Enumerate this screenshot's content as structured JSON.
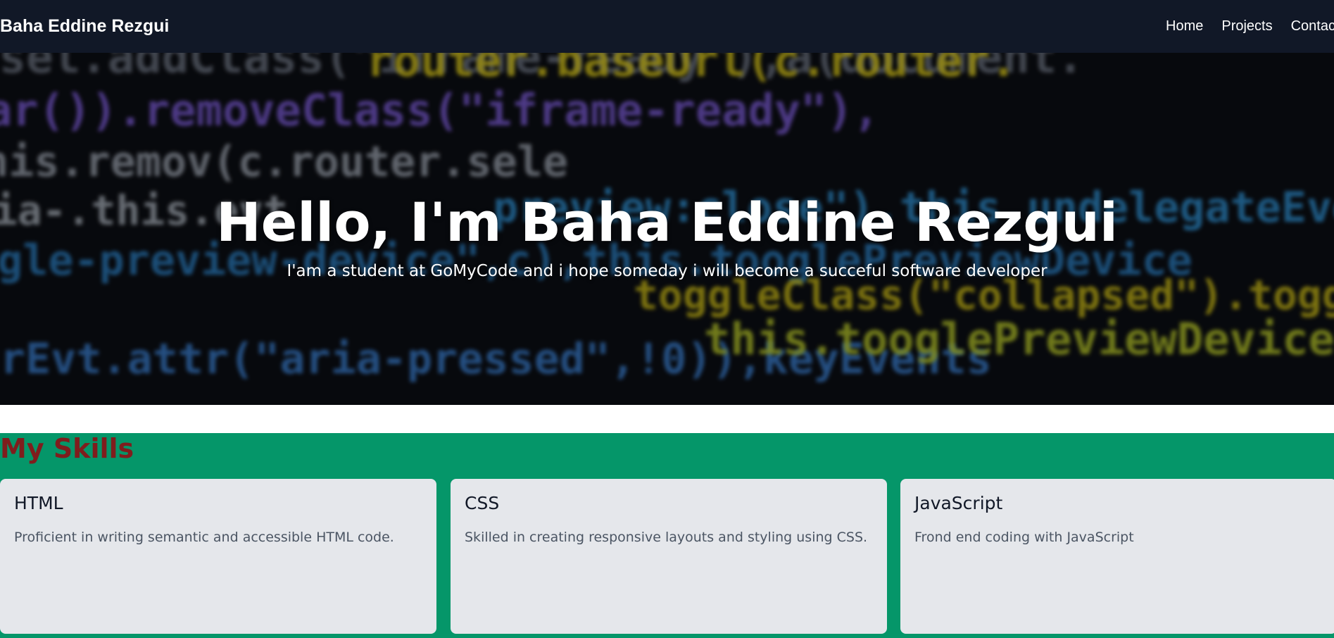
{
  "navbar": {
    "brand": "Baha Eddine Rezgui",
    "links": [
      "Home",
      "Projects",
      "Contact"
    ]
  },
  "hero": {
    "title": "Hello, I'm Baha Eddine Rezgui",
    "subtitle": "I'am a student at GoMyCode and i hope someday i will become a succeful software developer"
  },
  "skills": {
    "title": "My Skills",
    "cards": [
      {
        "title": "HTML",
        "description": "Proficient in writing semantic and accessible HTML code."
      },
      {
        "title": "CSS",
        "description": "Skilled in creating responsive layouts and styling using CSS."
      },
      {
        "title": "JavaScript",
        "description": "Frond end coding with JavaScript"
      }
    ]
  },
  "colors": {
    "navbar_bg": "#111827",
    "skills_bg": "#059669",
    "skills_title": "#7f1d1d",
    "card_bg": "#e5e7eb"
  }
}
